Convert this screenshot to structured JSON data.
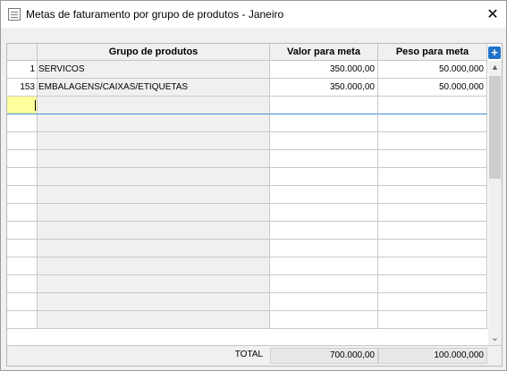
{
  "window": {
    "title": "Metas de faturamento por grupo de produtos - Janeiro",
    "close_glyph": "✕",
    "icon": "document-list-icon"
  },
  "grid": {
    "columns": [
      "",
      "Grupo de produtos",
      "Valor para meta",
      "Peso para meta"
    ],
    "add_button": "+",
    "rows": [
      {
        "code": "1",
        "group": "SERVICOS",
        "valor": "350.000,00",
        "peso": "50.000,000"
      },
      {
        "code": "153",
        "group": "EMBALAGENS/CAIXAS/ETIQUETAS",
        "valor": "350.000,00",
        "peso": "50.000,000"
      }
    ],
    "empty_rows": 14
  },
  "scrollbar": {
    "up_glyph": "▲",
    "down_glyph": "⌄"
  },
  "footer": {
    "total_label": "TOTAL",
    "total_valor": "700.000,00",
    "total_peso": "100.000,000"
  },
  "colors": {
    "active_cell": "#ffff9c",
    "add_button": "#1f74c9"
  }
}
